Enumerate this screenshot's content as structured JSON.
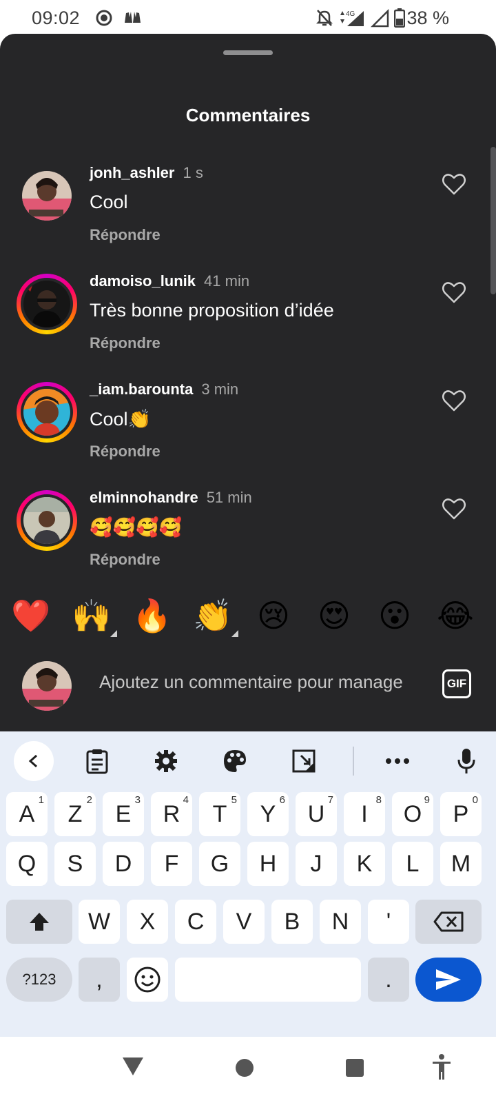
{
  "status_bar": {
    "time": "09:02",
    "battery": "38 %",
    "network": "4G"
  },
  "sheet": {
    "title": "Commentaires"
  },
  "comments": [
    {
      "username": "jonh_ashler",
      "time": "1 s",
      "text": "Cool",
      "reply": "Répondre"
    },
    {
      "username": "damoiso_lunik",
      "time": "41 min",
      "text": "Très bonne proposition d’idée",
      "reply": "Répondre"
    },
    {
      "username": "_iam.barounta",
      "time": "3 min",
      "text": "Cool👏",
      "reply": "Répondre"
    },
    {
      "username": "elminnohandre",
      "time": "51 min",
      "text": "🥰🥰🥰🥰",
      "reply": "Répondre"
    }
  ],
  "reactions": [
    "❤️",
    "🙌",
    "🔥",
    "👏",
    "😢",
    "😍",
    "😮",
    "😂"
  ],
  "composer": {
    "placeholder": "Ajoutez un commentaire pour manage",
    "gif_label": "GIF"
  },
  "keyboard": {
    "row1": [
      {
        "k": "A",
        "h": "1"
      },
      {
        "k": "Z",
        "h": "2"
      },
      {
        "k": "E",
        "h": "3"
      },
      {
        "k": "R",
        "h": "4"
      },
      {
        "k": "T",
        "h": "5"
      },
      {
        "k": "Y",
        "h": "6"
      },
      {
        "k": "U",
        "h": "7"
      },
      {
        "k": "I",
        "h": "8"
      },
      {
        "k": "O",
        "h": "9"
      },
      {
        "k": "P",
        "h": "0"
      }
    ],
    "row2": [
      "Q",
      "S",
      "D",
      "F",
      "G",
      "H",
      "J",
      "K",
      "L",
      "M"
    ],
    "row3": [
      "W",
      "X",
      "C",
      "V",
      "B",
      "N",
      "'"
    ],
    "symbols_label": "?123",
    "comma": ",",
    "period": "."
  },
  "colors": {
    "sheet_bg": "#262628",
    "keyboard_bg": "#e8eef8",
    "send_key": "#0b57d0",
    "story_ring": "#ff0069"
  }
}
